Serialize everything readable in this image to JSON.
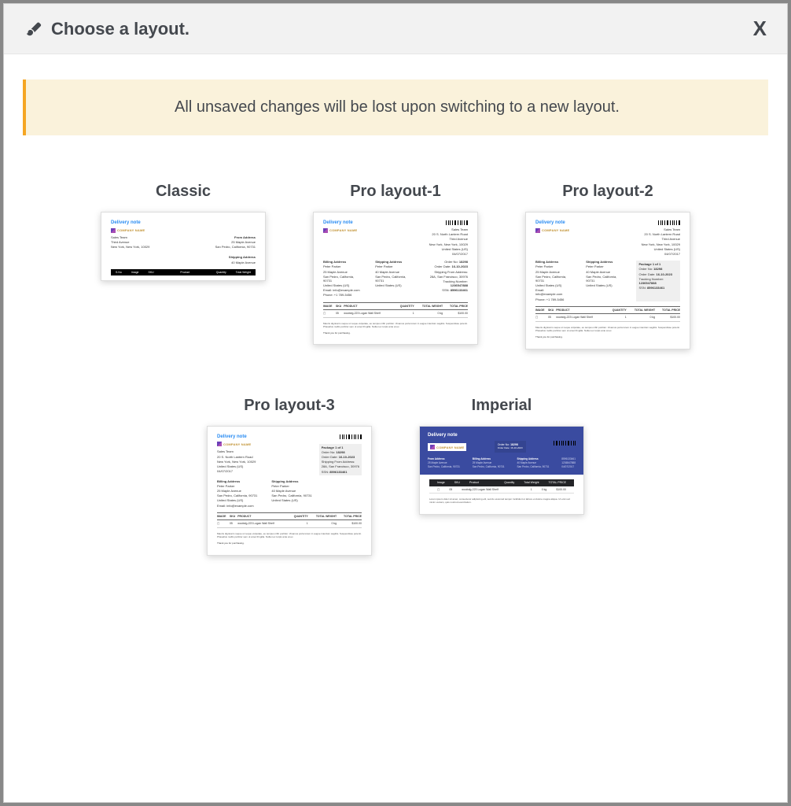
{
  "header": {
    "title": "Choose a layout.",
    "close_label": "X"
  },
  "alert": {
    "text": "All unsaved changes will be lost upon switching to a new layout."
  },
  "layouts": {
    "classic": {
      "label": "Classic"
    },
    "pro1": {
      "label": "Pro layout-1"
    },
    "pro2": {
      "label": "Pro layout-2"
    },
    "pro3": {
      "label": "Pro layout-3"
    },
    "imperial": {
      "label": "Imperial"
    }
  },
  "preview": {
    "doc_title": "Delivery note",
    "company_name": "COMPANY NAME",
    "sales_team": "Sales Team",
    "addr1": "20 S. North Lantern Road",
    "addr2": "Third Avenue",
    "addr3": "New York, New York, 10029",
    "country": "United States (US)",
    "date": "04/07/2017",
    "order_label": "Order No:",
    "order_no": "18298",
    "order_date_label": "Order Date:",
    "order_date": "16-10-2023",
    "ship_from_label": "Shipping From Address:",
    "ship_address": "28A, San Francisco, 30976",
    "tracking_label": "Tracking Number:",
    "tracking_no": "1236547888",
    "ssn_label": "SSN:",
    "ssn": "8596133461",
    "billing_head": "Billing Address",
    "shipping_head": "Shipping Address",
    "bill_name": "Peter Parker",
    "bill_addr": "25 Maple Avenue",
    "bill_city": "San Pedro, California, 90731",
    "bill_country": "United States (US)",
    "bill_email": "Email: info@example.com",
    "bill_phone": "Phone: +1 789-5456",
    "ship_addr": "40 Maple Avenue",
    "ship_city": "San Pedro, California, 90731",
    "ship_country": "United States (US)",
    "package_label": "Package 1 of 1",
    "th_image": "IMAGE",
    "th_sku": "SKU",
    "th_product": "PRODUCT",
    "th_qty": "QUANTITY",
    "th_weight": "TOTAL WEIGHT",
    "th_price": "TOTAL PRICE",
    "td_sku": "05",
    "td_product": "woobdg-223 Logan Wall Shelf",
    "td_qty": "1",
    "td_weight": "0 kg",
    "td_price": "$100.00",
    "note_text": "Mauris dignissim neque ut neque vulputate, eu tempus nibh porttitor. Vivamus porta lorem in augue interdum sagittis. Suspendisse potenti. Phasellus mollis porttitor sem ut amet fringilla. Nulla nec turpis ante at ex.",
    "thanks_text": "Thank you for purchasing.",
    "from_label": "From Address",
    "classic_sno": "S.No",
    "classic_image": "Image",
    "classic_sku": "SKU",
    "classic_product": "Product",
    "classic_qty": "Quantity",
    "classic_total": "Total Weight",
    "imperial_lorem": "Lorem ipsum dolor sit amet, consectetur adipiscing elit, sed do eiusmod tempor incididunt ut labore et dolore magna aliqua. Ut enim ad minim veniam, quis nostrud exercitation."
  }
}
